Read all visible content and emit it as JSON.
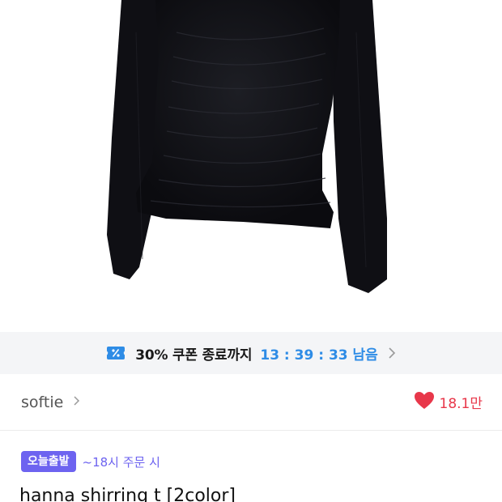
{
  "coupon": {
    "text": "30% 쿠폰 종료까지",
    "timer": "13 : 39 : 33 남음",
    "accent_color": "#2e8ce6",
    "icon": "coupon-ticket-icon"
  },
  "shop": {
    "name": "softie",
    "likes": "18.1만",
    "like_color": "#e8374a"
  },
  "delivery": {
    "badge": "오늘출발",
    "note": "~18시 주문 시",
    "badge_color": "#6d63f0"
  },
  "product": {
    "title": "hanna shirring t [2color]"
  }
}
